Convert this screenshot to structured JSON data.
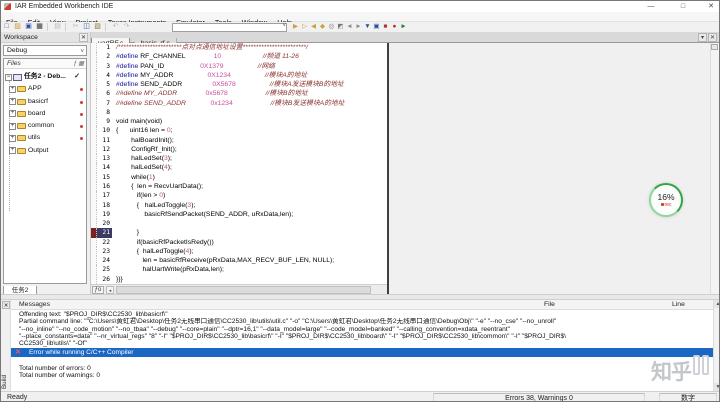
{
  "window": {
    "title": "IAR Embedded Workbench IDE",
    "min": "—",
    "max": "□",
    "close": "✕"
  },
  "menu": {
    "items": [
      "File",
      "Edit",
      "View",
      "Project",
      "Texas Instruments",
      "Emulator",
      "Tools",
      "Window",
      "Help"
    ]
  },
  "toolbar": {
    "buttons": [
      {
        "name": "new-document",
        "glyph": "□",
        "color": "#5a5a5a"
      },
      {
        "name": "open-file",
        "glyph": "▨",
        "color": "#c79a2e"
      },
      {
        "name": "save",
        "glyph": "▣",
        "color": "#2b4ea0"
      },
      {
        "name": "save-all",
        "glyph": "▦",
        "color": "#30302f"
      },
      {
        "sep": true
      },
      {
        "name": "print",
        "glyph": "▤",
        "off": true
      },
      {
        "sep": true
      },
      {
        "name": "cut",
        "glyph": "✂",
        "off": true
      },
      {
        "name": "copy",
        "glyph": "◫",
        "color": "#3a5da8"
      },
      {
        "name": "paste",
        "glyph": "▧",
        "color": "#8a7a3a"
      },
      {
        "sep": true
      },
      {
        "name": "undo",
        "glyph": "↶",
        "off": true
      },
      {
        "name": "redo",
        "glyph": "↷",
        "off": true
      },
      {
        "combo": true
      },
      {
        "name": "find",
        "glyph": "▶",
        "color": "#c8a23a",
        "sm": true
      },
      {
        "name": "find-next",
        "glyph": "▷",
        "color": "#c8a23a",
        "sm": true
      },
      {
        "name": "find-previous",
        "glyph": "◀",
        "color": "#c8a23a",
        "sm": true
      },
      {
        "name": "replace",
        "glyph": "◆",
        "color": "#c8a23a",
        "sm": true
      },
      {
        "name": "go-to",
        "glyph": "◎",
        "color": "#777777",
        "sm": true
      },
      {
        "name": "toggle-bookmark",
        "glyph": "◩",
        "color": "#777777",
        "sm": true
      },
      {
        "name": "navigate-back",
        "glyph": "◄",
        "color": "#8a8a8a",
        "sm": true
      },
      {
        "name": "navigate-forward",
        "glyph": "►",
        "color": "#8a8a8a",
        "sm": true
      },
      {
        "name": "make",
        "glyph": "▼",
        "color": "#2b4ea0",
        "sm": true
      },
      {
        "name": "compile",
        "glyph": "▣",
        "color": "#2b4ea0",
        "sm": true
      },
      {
        "name": "stop-build",
        "glyph": "■",
        "color": "#b23333",
        "sm": true
      },
      {
        "name": "debug",
        "glyph": "●",
        "color": "#b3262a",
        "sm": true
      },
      {
        "name": "download-and-debug",
        "glyph": "►",
        "color": "#1f7a2d",
        "sm": true
      }
    ],
    "find_combo_value": ""
  },
  "workspace": {
    "title": "Workspace",
    "config": "Debug",
    "files_header": "Files",
    "bottom_tab": "任务2",
    "tree": [
      {
        "name": "project-root",
        "label": "任务2 - Deb...",
        "root": true,
        "check": true
      },
      {
        "name": "folder-app",
        "label": "APP",
        "dot": true
      },
      {
        "name": "folder-basicrf",
        "label": "basicrf",
        "dot": true
      },
      {
        "name": "folder-board",
        "label": "board",
        "dot": true
      },
      {
        "name": "folder-common",
        "label": "common",
        "dot": true
      },
      {
        "name": "folder-utils",
        "label": "utils",
        "dot": true
      },
      {
        "name": "folder-output",
        "label": "Output",
        "dot": false
      }
    ]
  },
  "editor": {
    "tabs": [
      {
        "label": "uartRF.c",
        "active": true
      },
      {
        "label": "basic_rf.c",
        "active": false
      }
    ],
    "current_line": 21,
    "code": [
      {
        "n": 1,
        "s": [
          [
            "/************************点对点通信地址设置************************/",
            "c"
          ]
        ]
      },
      {
        "n": 2,
        "s": [
          [
            "#define",
            "p"
          ],
          [
            " RF_CHANNEL               ",
            "t"
          ],
          [
            "10",
            "n"
          ],
          [
            "                      ",
            "t"
          ],
          [
            "//频道 11-26",
            "c"
          ]
        ]
      },
      {
        "n": 3,
        "s": [
          [
            "#define",
            "p"
          ],
          [
            " PAN_ID                   ",
            "t"
          ],
          [
            "0X1379",
            "n"
          ],
          [
            "                  ",
            "t"
          ],
          [
            "//网络",
            "c"
          ]
        ]
      },
      {
        "n": 4,
        "s": [
          [
            "#define",
            "p"
          ],
          [
            " MY_ADDR                  ",
            "t"
          ],
          [
            "0X1234",
            "n"
          ],
          [
            "                  ",
            "t"
          ],
          [
            "//模块A的地址",
            "c"
          ]
        ]
      },
      {
        "n": 5,
        "s": [
          [
            "#define",
            "p"
          ],
          [
            " SEND_ADDR                ",
            "t"
          ],
          [
            "0X5678",
            "n"
          ],
          [
            "                  ",
            "t"
          ],
          [
            "//模块A发送模块B的地址",
            "c"
          ]
        ]
      },
      {
        "n": 6,
        "s": [
          [
            "//#define MY_ADDR               ",
            "c"
          ],
          [
            "0x5678",
            "n"
          ],
          [
            "                    ",
            "t"
          ],
          [
            "//模块B的地址",
            "c"
          ]
        ]
      },
      {
        "n": 7,
        "s": [
          [
            "//#define SEND_ADDR             ",
            "c"
          ],
          [
            "0x1234",
            "n"
          ],
          [
            "                    ",
            "t"
          ],
          [
            "//模块B发送模块A的地址",
            "c"
          ]
        ]
      },
      {
        "n": 8,
        "s": []
      },
      {
        "n": 9,
        "s": [
          [
            "void main(void)",
            "t"
          ]
        ]
      },
      {
        "n": 10,
        "s": [
          [
            "{      uint16 len = ",
            "t"
          ],
          [
            "0",
            "n"
          ],
          [
            ";",
            "t"
          ]
        ]
      },
      {
        "n": 11,
        "s": [
          [
            "        halBoardInit();",
            "t"
          ]
        ]
      },
      {
        "n": 12,
        "s": [
          [
            "        ConfigRf_Init();",
            "t"
          ]
        ]
      },
      {
        "n": 13,
        "s": [
          [
            "        halLedSet(",
            "t"
          ],
          [
            "3",
            "n"
          ],
          [
            ");",
            "t"
          ]
        ]
      },
      {
        "n": 14,
        "s": [
          [
            "        halLedSet(",
            "t"
          ],
          [
            "4",
            "n"
          ],
          [
            ");",
            "t"
          ]
        ]
      },
      {
        "n": 15,
        "s": [
          [
            "        while(",
            "t"
          ],
          [
            "1",
            "n"
          ],
          [
            ")",
            "t"
          ]
        ]
      },
      {
        "n": 16,
        "s": [
          [
            "        {  len = RecvUartData();",
            "t"
          ]
        ]
      },
      {
        "n": 17,
        "s": [
          [
            "           if(len > ",
            "t"
          ],
          [
            "0",
            "n"
          ],
          [
            ")",
            "t"
          ]
        ]
      },
      {
        "n": 18,
        "s": [
          [
            "           {   halLedToggle(",
            "t"
          ],
          [
            "3",
            "n"
          ],
          [
            ");",
            "t"
          ]
        ]
      },
      {
        "n": 19,
        "s": [
          [
            "               basicRfSendPacket(SEND_ADDR, uRxData,len);",
            "t"
          ]
        ]
      },
      {
        "n": 20,
        "s": []
      },
      {
        "n": 21,
        "s": [
          [
            "           }",
            "t"
          ]
        ]
      },
      {
        "n": 22,
        "s": [
          [
            "           if(basicRfPacketIsRedy())",
            "t"
          ]
        ]
      },
      {
        "n": 23,
        "s": [
          [
            "           {  halLedToggle(",
            "t"
          ],
          [
            "4",
            "n"
          ],
          [
            ");",
            "t"
          ]
        ]
      },
      {
        "n": 24,
        "s": [
          [
            "              len = basicRfReceive(pRxData,MAX_RECV_BUF_LEN, NULL);",
            "t"
          ]
        ]
      },
      {
        "n": 25,
        "s": [
          [
            "              halUartWrite(pRxData,len);",
            "t"
          ]
        ]
      },
      {
        "n": 26,
        "s": [
          [
            "}}}",
            "t"
          ]
        ]
      }
    ]
  },
  "messages": {
    "build_tab": "Build",
    "header": "Messages",
    "col_file": "File",
    "col_line": "Line",
    "rows": [
      {
        "type": "normal",
        "text": "Offending text: \"$PROJ_DIR$\\CC2530_lib\\basicrf\\\""
      },
      {
        "type": "normal",
        "text": "Partial command line: \"\"C:\\Users\\黄虹君\\Desktop\\任务2无线串口通信\\CC2530_lib\\utils\\util.c\" \"-o\" \"C:\\Users\\黄虹君\\Desktop\\任务2无线串口通信\\Debug\\Obj\\\" \"-e\" \"--no_cse\" \"--no_unroll\""
      },
      {
        "type": "normal",
        "text": "\"--no_inline\" \"--no_code_motion\" \"--no_tbaa\" \"--debug\" \"--core=plain\" \"--dptr=16,1\" \"--data_model=large\" \"--code_model=banked\" \"--calling_convention=xdata_reentrant\""
      },
      {
        "type": "normal",
        "text": "\"--place_constants=data\" \"--nr_virtual_regs\" \"8\" \"-I\" \"$PROJ_DIR$\\CC2530_lib\\basicrf\\\" \"-I\" \"$PROJ_DIR$\\CC2530_lib\\board\\\" \"-I\" \"$PROJ_DIR$\\CC2530_lib\\common\\\" \"-I\" \"$PROJ_DIR$\\"
      },
      {
        "type": "normal",
        "text": "CC2530_lib\\utils\\\" \"-Of\""
      },
      {
        "type": "error",
        "text": "Error while running C/C++ Compiler"
      },
      {
        "type": "normal",
        "text": ""
      },
      {
        "type": "normal",
        "text": "Total number of errors: 0"
      },
      {
        "type": "normal",
        "text": "Total number of warnings: 0"
      }
    ]
  },
  "status": {
    "ready": "Ready",
    "errors": "Errors 38, Warnings 0",
    "numlock": "数字"
  },
  "overlay": {
    "percent": "16%",
    "rec": "rec"
  },
  "watermark": {
    "text": "知乎"
  },
  "colors": {
    "error_row": "#1b67c4",
    "comment": "#8b3332",
    "number": "#c94f9b",
    "preprocessor": "#14149b",
    "record_ring": "#2ea843"
  }
}
